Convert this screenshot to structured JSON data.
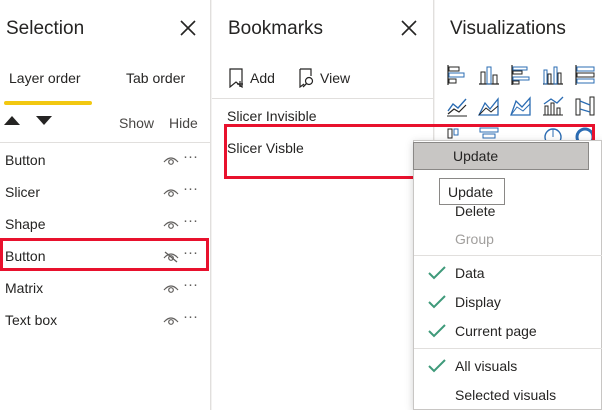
{
  "selection": {
    "title": "Selection",
    "tabs": [
      {
        "label": "Layer order"
      },
      {
        "label": "Tab order"
      }
    ],
    "show_label": "Show",
    "hide_label": "Hide",
    "layers": [
      {
        "label": "Button",
        "visible": true
      },
      {
        "label": "Slicer",
        "visible": true
      },
      {
        "label": "Shape",
        "visible": true
      },
      {
        "label": "Button",
        "visible": false
      },
      {
        "label": "Matrix",
        "visible": true
      },
      {
        "label": "Text box",
        "visible": true
      }
    ],
    "more_glyph": "···"
  },
  "bookmarks": {
    "title": "Bookmarks",
    "add_label": "Add",
    "view_label": "View",
    "items": [
      {
        "label": "Slicer Invisible"
      },
      {
        "label": "Slicer Visble"
      }
    ]
  },
  "visualizations": {
    "title": "Visualizations"
  },
  "context_menu": {
    "update_label": "Update",
    "tooltip": "Update",
    "items": [
      {
        "label": "Delete",
        "disabled": false,
        "checked": false
      },
      {
        "label": "Group",
        "disabled": true,
        "checked": false
      },
      {
        "label": "Data",
        "disabled": false,
        "checked": true
      },
      {
        "label": "Display",
        "disabled": false,
        "checked": true
      },
      {
        "label": "Current page",
        "disabled": false,
        "checked": true
      },
      {
        "label": "All visuals",
        "disabled": false,
        "checked": true
      },
      {
        "label": "Selected visuals",
        "disabled": false,
        "checked": false
      }
    ]
  },
  "colors": {
    "accent": "#f2c811",
    "highlight_red": "#e8112d",
    "check_green": "#3f9a7a",
    "viz_blue": "#2b6cb3"
  }
}
